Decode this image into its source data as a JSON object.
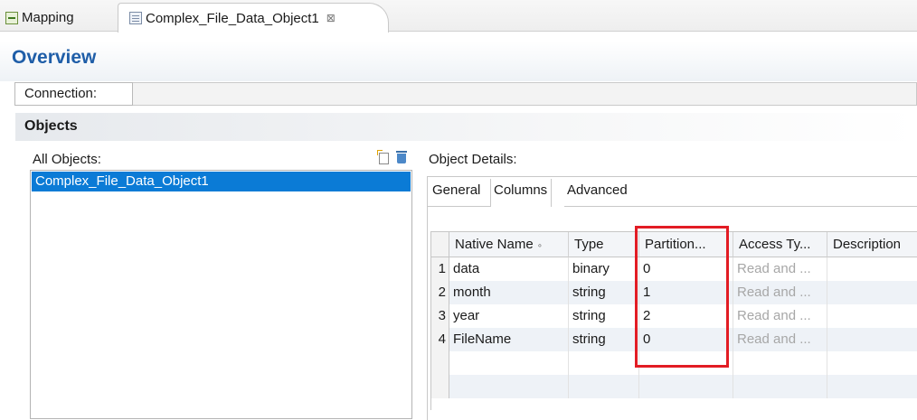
{
  "tabs": [
    {
      "label": "Mapping",
      "icon": "mapping-icon"
    },
    {
      "label": "Complex_File_Data_Object1",
      "icon": "data-object-icon",
      "close": "⊠"
    }
  ],
  "overview": {
    "title": "Overview"
  },
  "connection": {
    "label": "Connection:",
    "value": ""
  },
  "objects": {
    "title": "Objects",
    "all_objects_label": "All Objects:",
    "items": [
      "Complex_File_Data_Object1"
    ],
    "selected": "Complex_File_Data_Object1"
  },
  "details": {
    "label": "Object Details:",
    "tabs": [
      "General",
      "Columns",
      "Advanced"
    ],
    "active_tab": "Columns",
    "columns": {
      "headers": [
        "Native Name",
        "Type",
        "Partition...",
        "Access Ty...",
        "Description"
      ],
      "sort_indicator": "∘",
      "rows": [
        {
          "index": "1",
          "native_name": "data",
          "type": "binary",
          "partition": "0",
          "access": "Read and ..."
        },
        {
          "index": "2",
          "native_name": "month",
          "type": "string",
          "partition": "1",
          "access": "Read and ..."
        },
        {
          "index": "3",
          "native_name": "year",
          "type": "string",
          "partition": "2",
          "access": "Read and ..."
        },
        {
          "index": "4",
          "native_name": "FileName",
          "type": "string",
          "partition": "0",
          "access": "Read and ..."
        }
      ]
    }
  },
  "colors": {
    "accent_title": "#1f5ea8",
    "selection": "#0b7bd6",
    "highlight_box": "#e21c24",
    "row_alt": "#eef2f7"
  }
}
